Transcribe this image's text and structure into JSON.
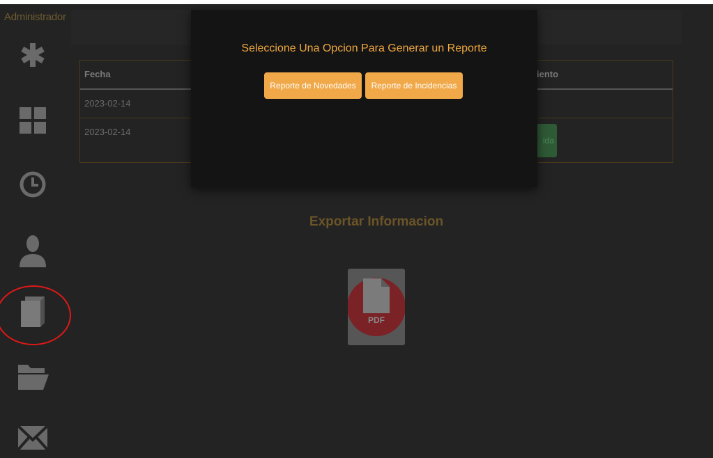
{
  "sidebar": {
    "user_label": "Administrador",
    "items": [
      {
        "icon": "asterisk-icon"
      },
      {
        "icon": "grid-icon"
      },
      {
        "icon": "clock-icon"
      },
      {
        "icon": "user-icon"
      },
      {
        "icon": "book-icon"
      },
      {
        "icon": "folder-icon"
      },
      {
        "icon": "mail-icon"
      }
    ]
  },
  "table": {
    "headers": [
      "Fecha",
      "iento"
    ],
    "rows": [
      {
        "fecha": "2023-02-14",
        "status": ""
      },
      {
        "fecha": "2023-02-14",
        "status": "ida"
      }
    ]
  },
  "export": {
    "title": "Exportar Informacion",
    "pdf_label": "PDF"
  },
  "modal": {
    "title": "Seleccione Una Opcion Para Generar un Reporte",
    "buttons": {
      "novedades": "Reporte de Novedades",
      "incidencias": "Reporte de Incidencias"
    }
  },
  "colors": {
    "accent": "#f0a848",
    "background": "#232323",
    "modal_bg": "#141414",
    "highlight": "#e01818"
  }
}
